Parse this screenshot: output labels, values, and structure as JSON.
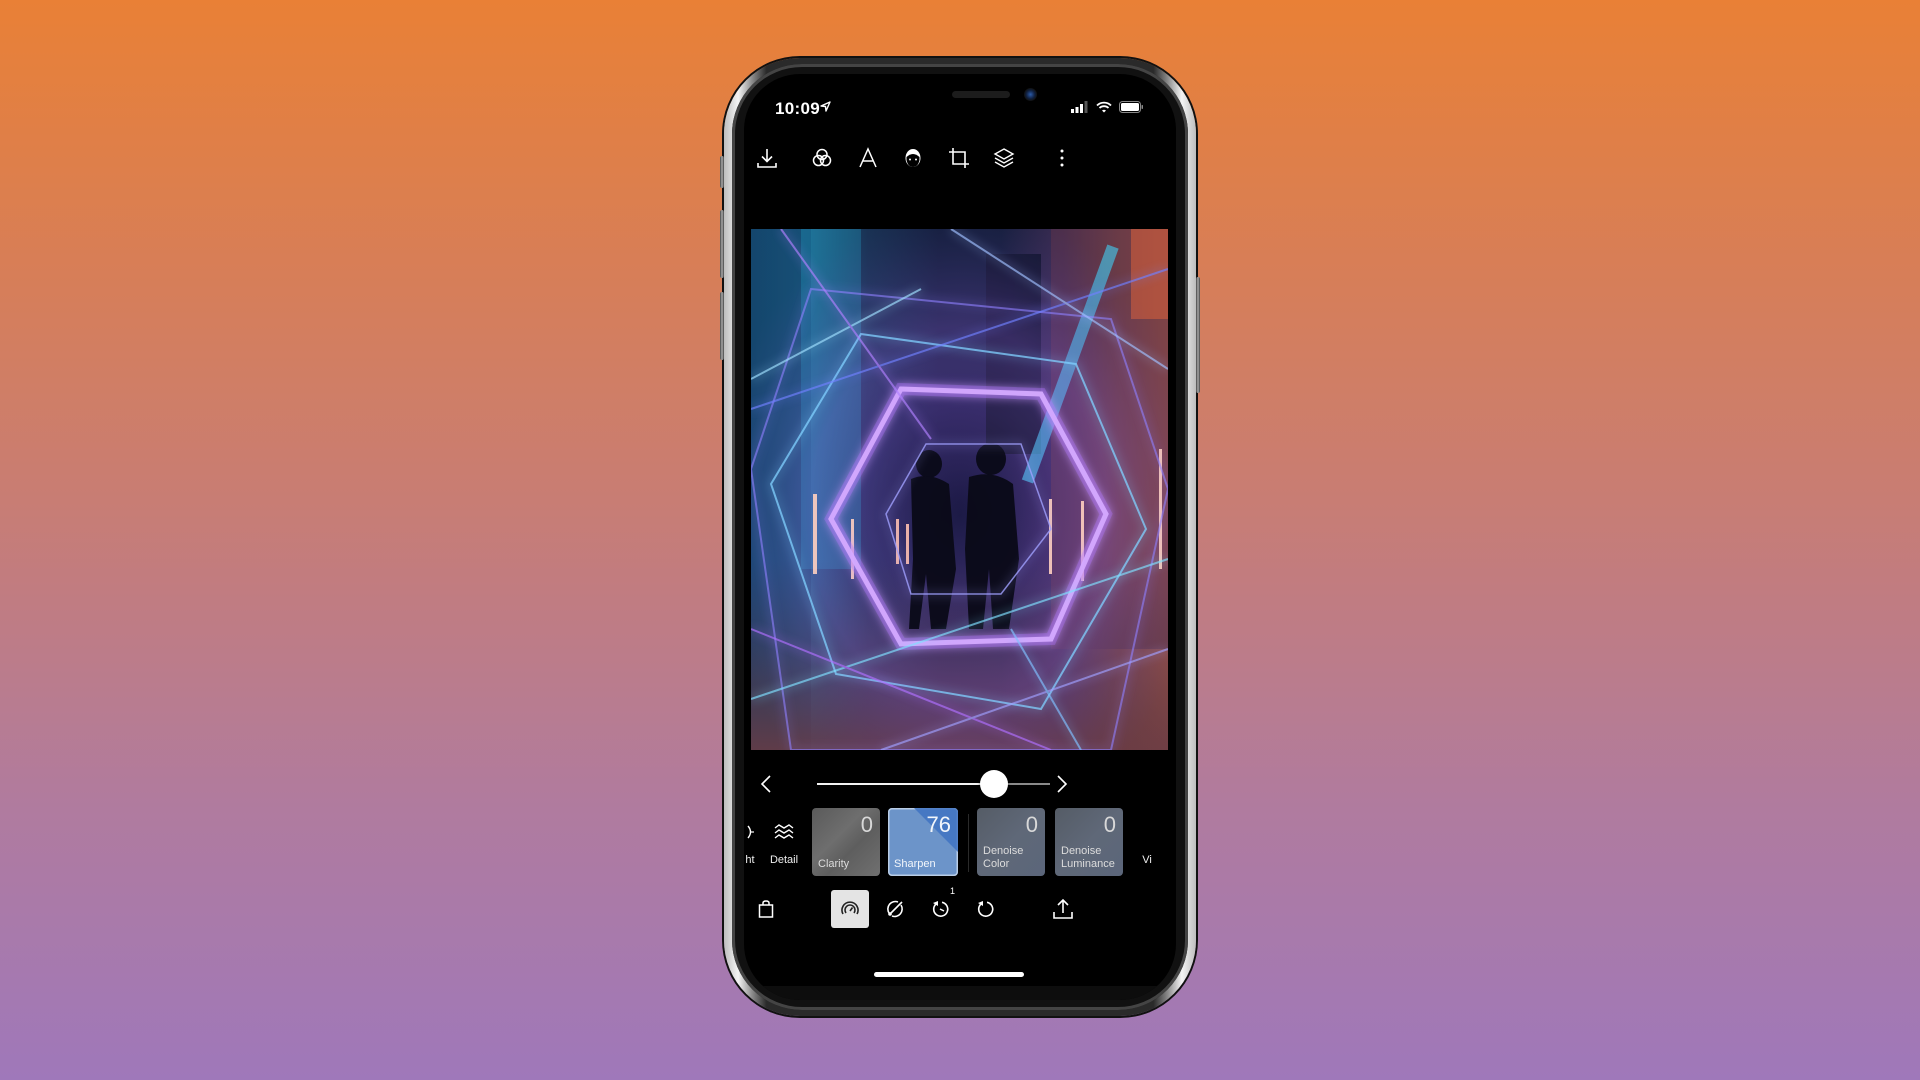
{
  "status_bar": {
    "time": "10:09",
    "location_icon": "location-arrow-icon",
    "signal_bars_filled": 3,
    "signal_bars_total": 4,
    "wifi_icon": "wifi-icon",
    "battery_level": 1.0
  },
  "top_toolbar": {
    "items": [
      {
        "name": "download",
        "icon": "download-icon"
      },
      {
        "name": "filters",
        "icon": "overlapping-circles-icon"
      },
      {
        "name": "text",
        "icon": "text-a-icon"
      },
      {
        "name": "face",
        "icon": "face-icon"
      },
      {
        "name": "crop",
        "icon": "crop-icon"
      },
      {
        "name": "layers",
        "icon": "layers-icon"
      },
      {
        "name": "more",
        "icon": "more-vertical-icon"
      }
    ]
  },
  "photo": {
    "description": "Night city street with two people framed by glowing neon hexagon light effects"
  },
  "adjustment_slider": {
    "value": 76,
    "min": 0,
    "max": 100,
    "prev_icon": "chevron-left-icon",
    "next_icon": "chevron-right-icon"
  },
  "tools": {
    "partial_left_label": "ht",
    "detail_label": "Detail",
    "cards": [
      {
        "label": "Clarity",
        "value": "0",
        "active": false
      },
      {
        "label": "Sharpen",
        "value": "76",
        "active": true
      },
      {
        "label": "Denoise Color",
        "line1": "Denoise",
        "line2": "Color",
        "value": "0",
        "active": false
      },
      {
        "label": "Denoise Luminance",
        "line1": "Denoise",
        "line2": "Luminance",
        "value": "0",
        "active": false
      }
    ],
    "partial_right_label": "Vi"
  },
  "bottom_toolbar": {
    "items": [
      {
        "name": "shop",
        "icon": "shopping-bag-icon"
      },
      {
        "name": "adjust",
        "icon": "gauge-icon",
        "active": true
      },
      {
        "name": "brush",
        "icon": "brush-icon"
      },
      {
        "name": "history",
        "icon": "history-icon",
        "badge": "1"
      },
      {
        "name": "undo",
        "icon": "undo-icon"
      },
      {
        "name": "share",
        "icon": "share-icon"
      }
    ]
  },
  "colors": {
    "background_top": "#E98036",
    "background_bottom": "#9F78BA",
    "active_card": "#6C94C9",
    "active_card_corner": "#3F73C2"
  }
}
